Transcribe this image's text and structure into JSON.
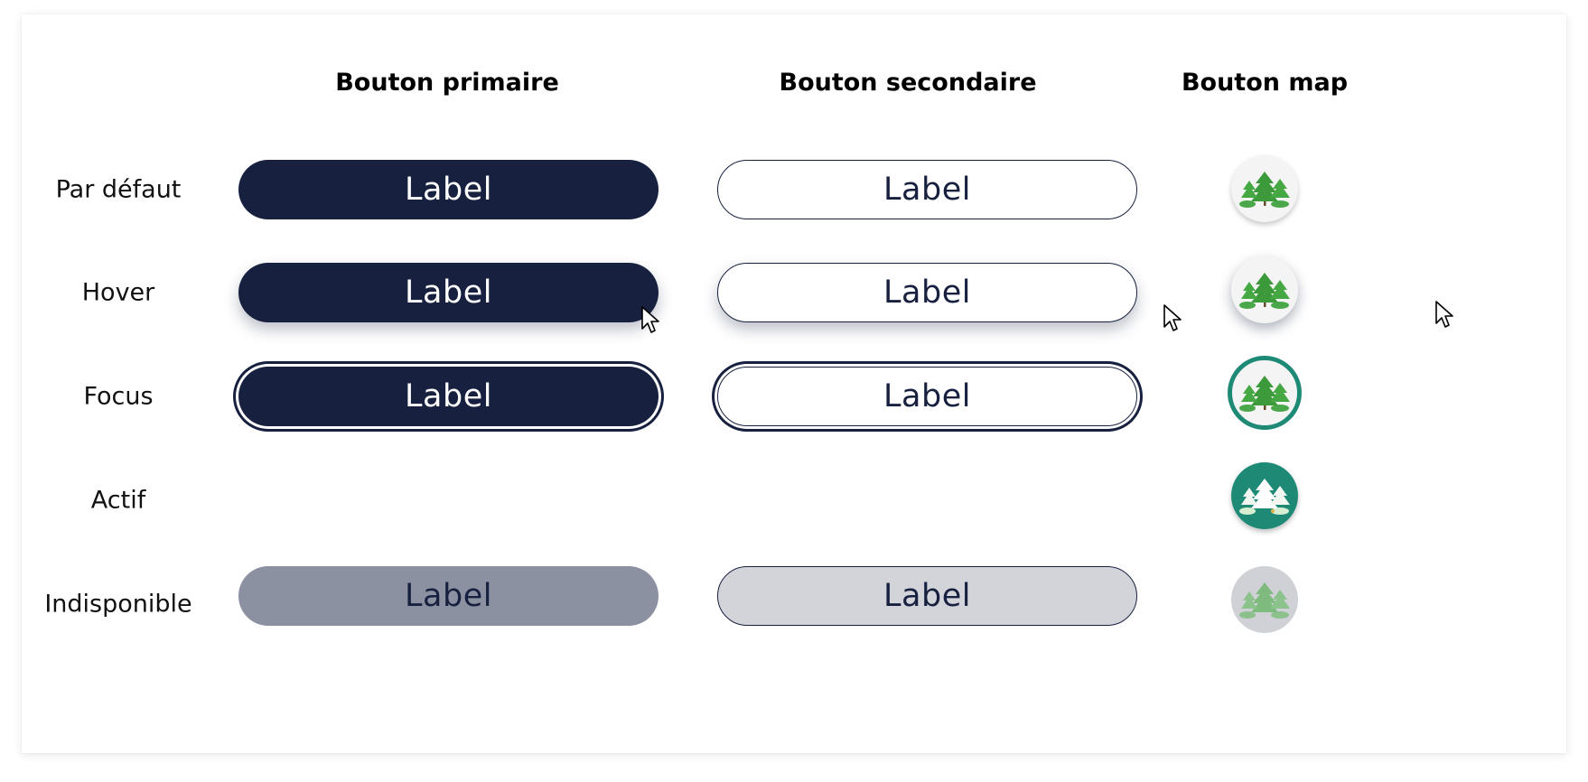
{
  "headers": {
    "primary": "Bouton primaire",
    "secondary": "Bouton secondaire",
    "map": "Bouton map"
  },
  "rows": {
    "default": "Par défaut",
    "hover": "Hover",
    "focus": "Focus",
    "active": "Actif",
    "disabled": "Indisponible"
  },
  "button_label": "Label",
  "icons": {
    "map_button": "forest-trees-icon",
    "cursor": "mouse-pointer-icon"
  },
  "colors": {
    "navy": "#17213f",
    "teal": "#1e8a76",
    "tree_green": "#3c9a3a",
    "disabled_primary": "#8b91a1",
    "disabled_secondary": "#d2d4da"
  }
}
